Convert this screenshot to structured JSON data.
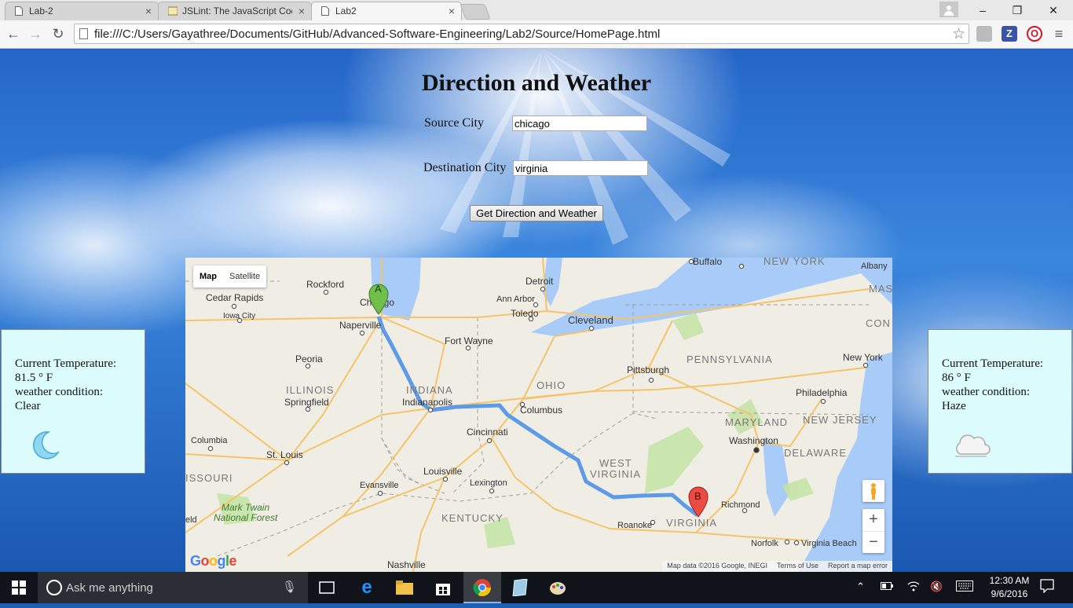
{
  "browser": {
    "tabs": [
      {
        "label": "Lab-2",
        "close": "×"
      },
      {
        "label": "JSLint: The JavaScript Code",
        "close": "×"
      },
      {
        "label": "Lab2",
        "close": "×"
      }
    ],
    "window_controls": {
      "minimize": "–",
      "restore": "❐",
      "close": "✕"
    },
    "nav": {
      "back": "←",
      "forward": "→",
      "reload": "↻"
    },
    "url": "file:///C:/Users/Gayathree/Documents/GitHub/Advanced-Software-Engineering/Lab2/Source/HomePage.html",
    "star": "☆",
    "extensions": [
      {
        "letter": "Z"
      },
      {
        "letter": "O"
      }
    ],
    "menu": "≡"
  },
  "page": {
    "title": "Direction and Weather",
    "source_label": "Source City",
    "source_value": "chicago",
    "destination_label": "Destination City",
    "destination_value": "virginia",
    "button_label": "Get Direction and Weather"
  },
  "weather_left": {
    "temp_label": "Current Temperature:",
    "temp_value": "81.5 ° F",
    "condition_label": "weather condition:",
    "condition_value": "Clear",
    "icon": "moon-icon"
  },
  "weather_right": {
    "temp_label": "Current Temperature:",
    "temp_value": "86 ° F",
    "condition_label": "weather condition:",
    "condition_value": "Haze",
    "icon": "cloud-icon"
  },
  "map": {
    "type_map": "Map",
    "type_satellite": "Satellite",
    "zoom_in": "+",
    "zoom_out": "−",
    "marker_a": "A",
    "marker_b": "B",
    "logo": "Google",
    "footer": {
      "attribution": "Map data ©2016 Google, INEGI",
      "terms": "Terms of Use",
      "report": "Report a map error"
    },
    "cities": {
      "buffalo": "Buffalo",
      "albany": "Albany",
      "detroit": "Detroit",
      "rockford": "Rockford",
      "cedar_rapids": "Cedar Rapids",
      "chicago": "Chicago",
      "ann_arbor": "Ann Arbor",
      "iowa_city": "Iowa City",
      "naperville": "Naperville",
      "toledo": "Toledo",
      "cleveland": "Cleveland",
      "fort_wayne": "Fort Wayne",
      "peoria": "Peoria",
      "pittsburgh": "Pittsburgh",
      "new_york": "New York",
      "indianapolis": "Indianapolis",
      "springfield": "Springfield",
      "columbus": "Columbus",
      "philadelphia": "Philadelphia",
      "cincinnati": "Cincinnati",
      "washington": "Washington",
      "columbia": "Columbia",
      "st_louis": "St. Louis",
      "louisville": "Louisville",
      "evansville": "Evansville",
      "lexington": "Lexington",
      "richmond": "Richmond",
      "roanoke": "Roanoke",
      "norfolk": "Norfolk",
      "virginia_beach": "Virginia Beach",
      "nashville": "Nashville",
      "mark_twain": "Mark Twain",
      "national_forest": "National Forest",
      "eld": "eld",
      "mas": "MAS",
      "con": "CON"
    },
    "states": {
      "new_york": "NEW YORK",
      "pennsylvania": "PENNSYLVANIA",
      "illinois": "ILLINOIS",
      "indiana": "INDIANA",
      "ohio": "OHIO",
      "maryland": "MARYLAND",
      "new_jersey": "NEW JERSEY",
      "delaware": "DELAWARE",
      "west": "WEST",
      "virginia_wv": "VIRGINIA",
      "missouri": "ISSOURI",
      "kentucky": "KENTUCKY",
      "virginia": "VIRGINIA"
    }
  },
  "taskbar": {
    "search_placeholder": "Ask me anything",
    "time": "12:30 AM",
    "date": "9/6/2016"
  }
}
